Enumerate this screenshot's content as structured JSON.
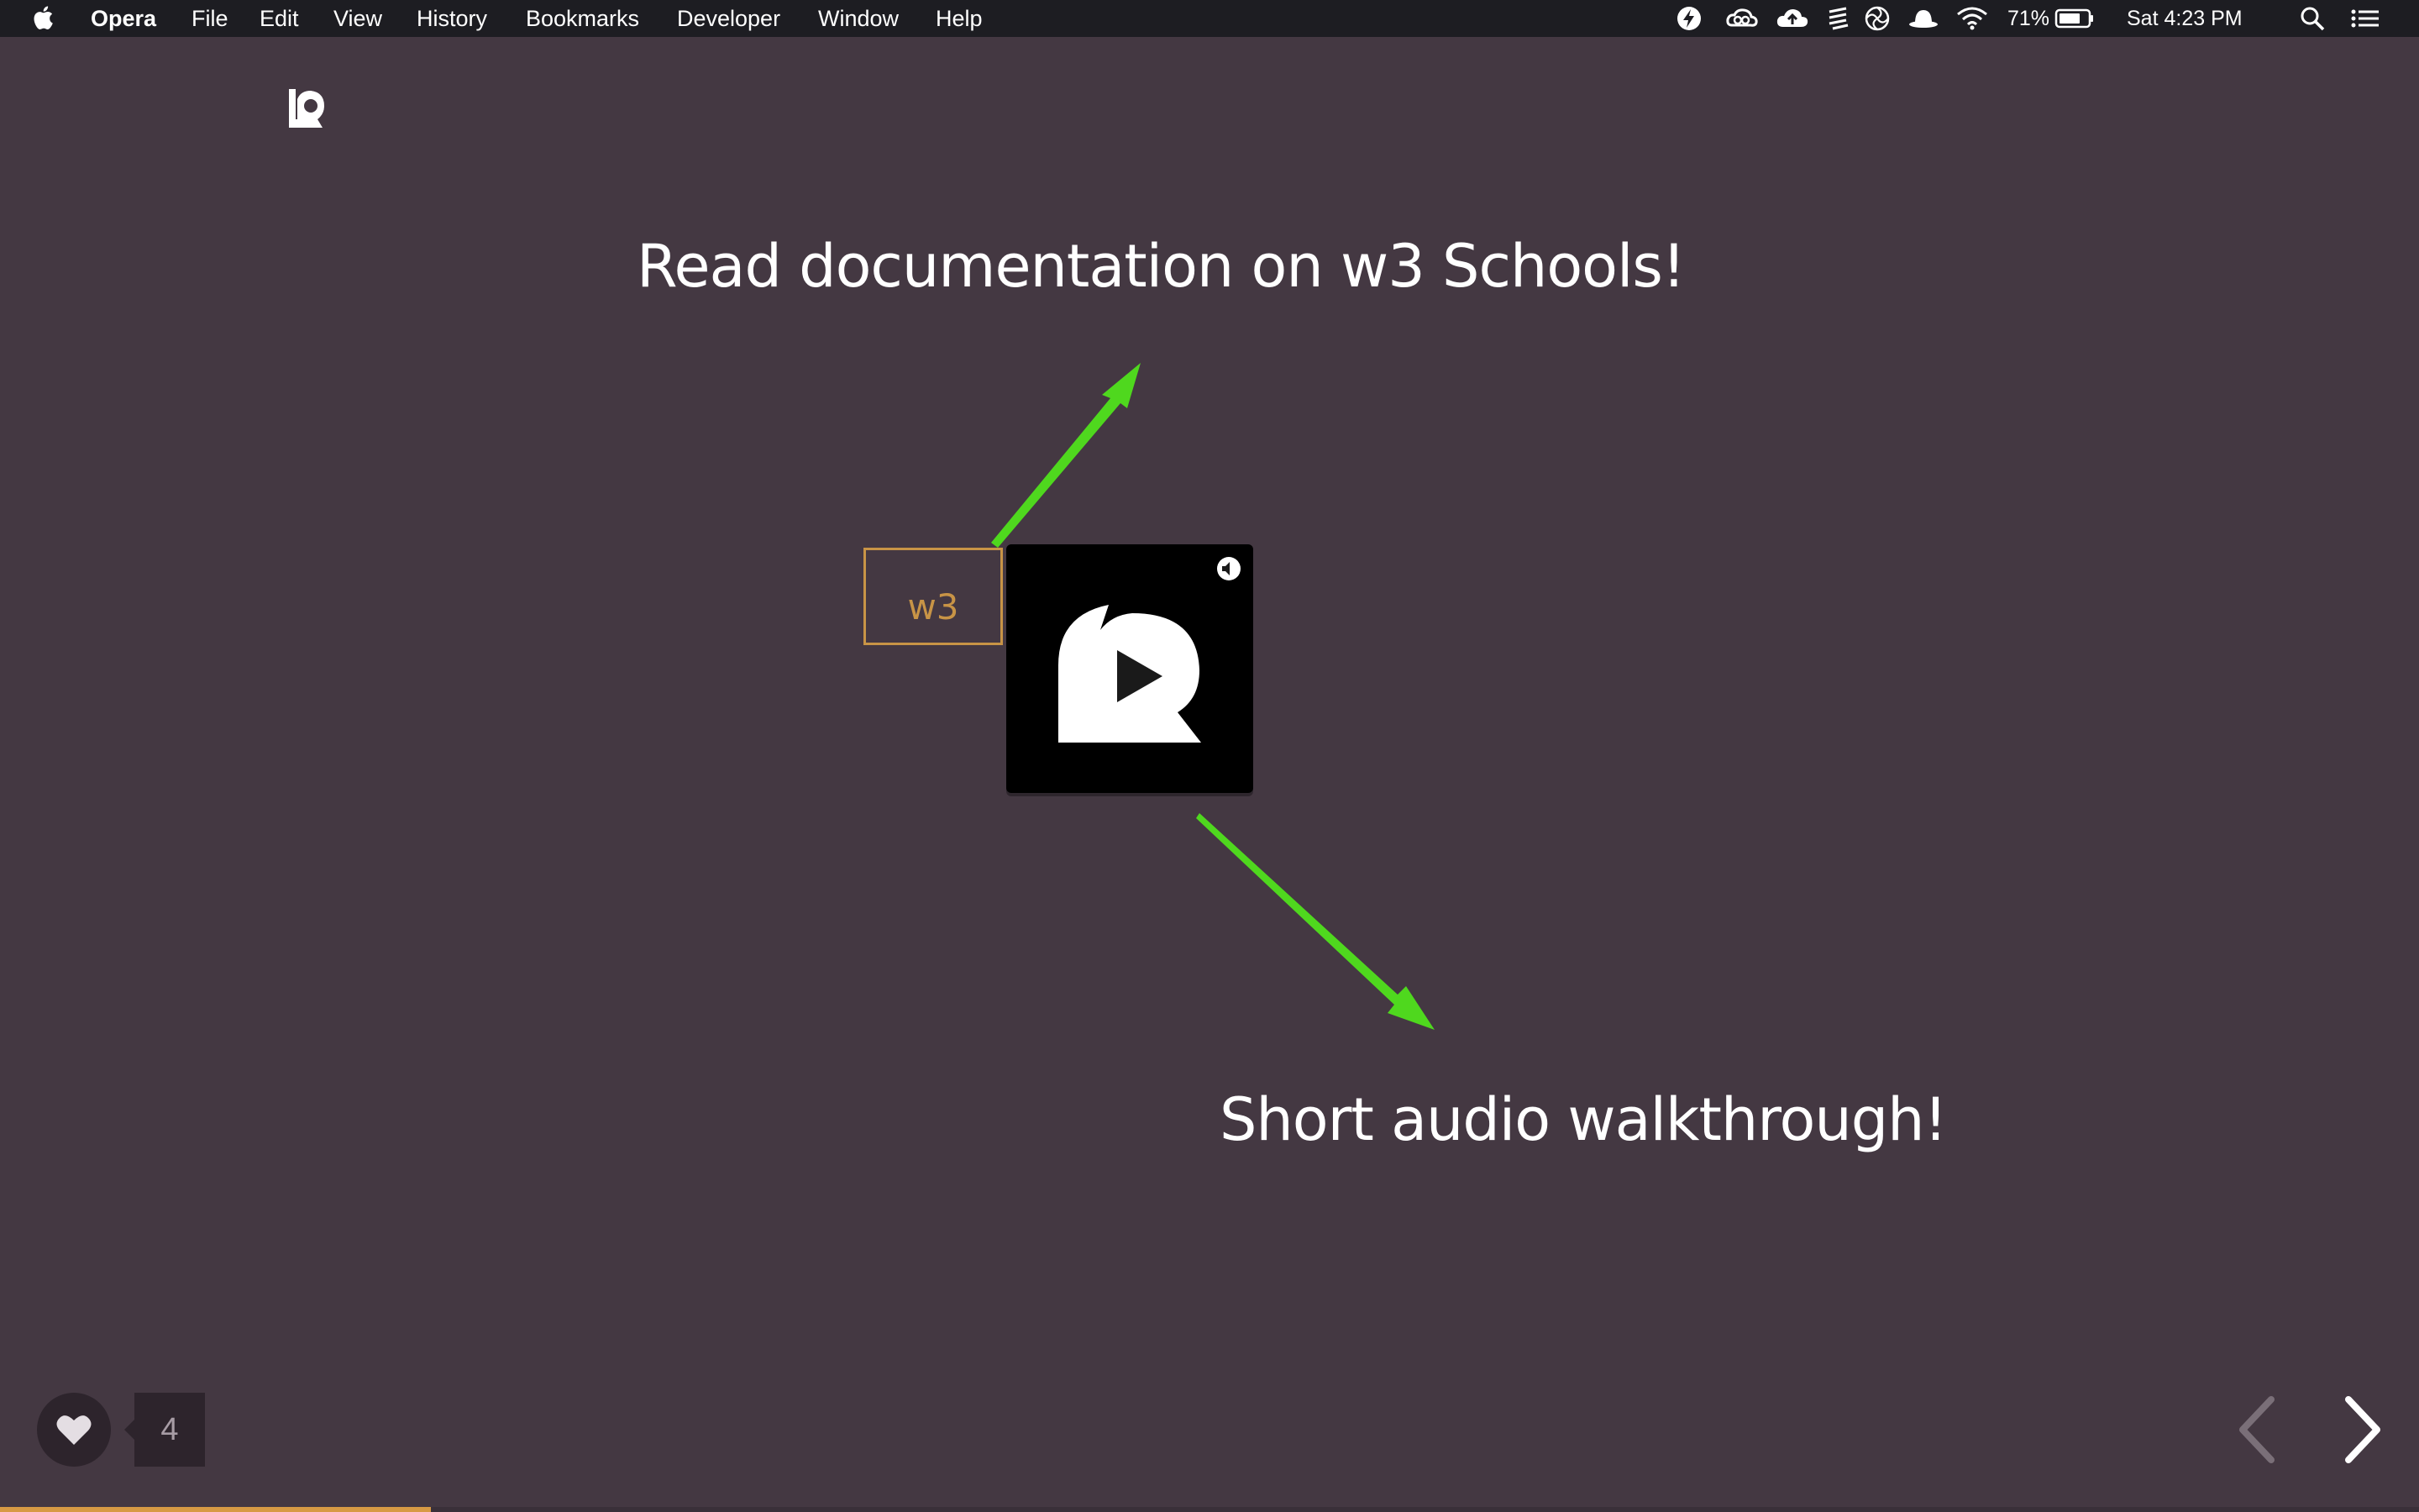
{
  "menubar": {
    "app_name": "Opera",
    "items": [
      "File",
      "Edit",
      "View",
      "History",
      "Bookmarks",
      "Developer",
      "Window",
      "Help"
    ],
    "status_icons": [
      "bolt-icon",
      "creative-cloud-icon",
      "cloud-upload-icon",
      "stack-icon",
      "swirl-icon",
      "hat-icon",
      "wifi-icon"
    ],
    "battery": "71%",
    "clock": "Sat 4:23 PM"
  },
  "slide": {
    "headline_top": "Read documentation on w3 Schools!",
    "headline_bottom": "Short audio walkthrough!",
    "w3_link_label": "w3",
    "audio_player": {
      "icon": "play-icon",
      "volume_icon": "speaker-icon"
    },
    "arrow_color": "#4fd81e"
  },
  "footer": {
    "like_count": "4",
    "progress": 0.178
  },
  "colors": {
    "background": "#443842",
    "menubar": "#1d1d22",
    "accent": "#c89446",
    "progress": "#d79a44"
  }
}
